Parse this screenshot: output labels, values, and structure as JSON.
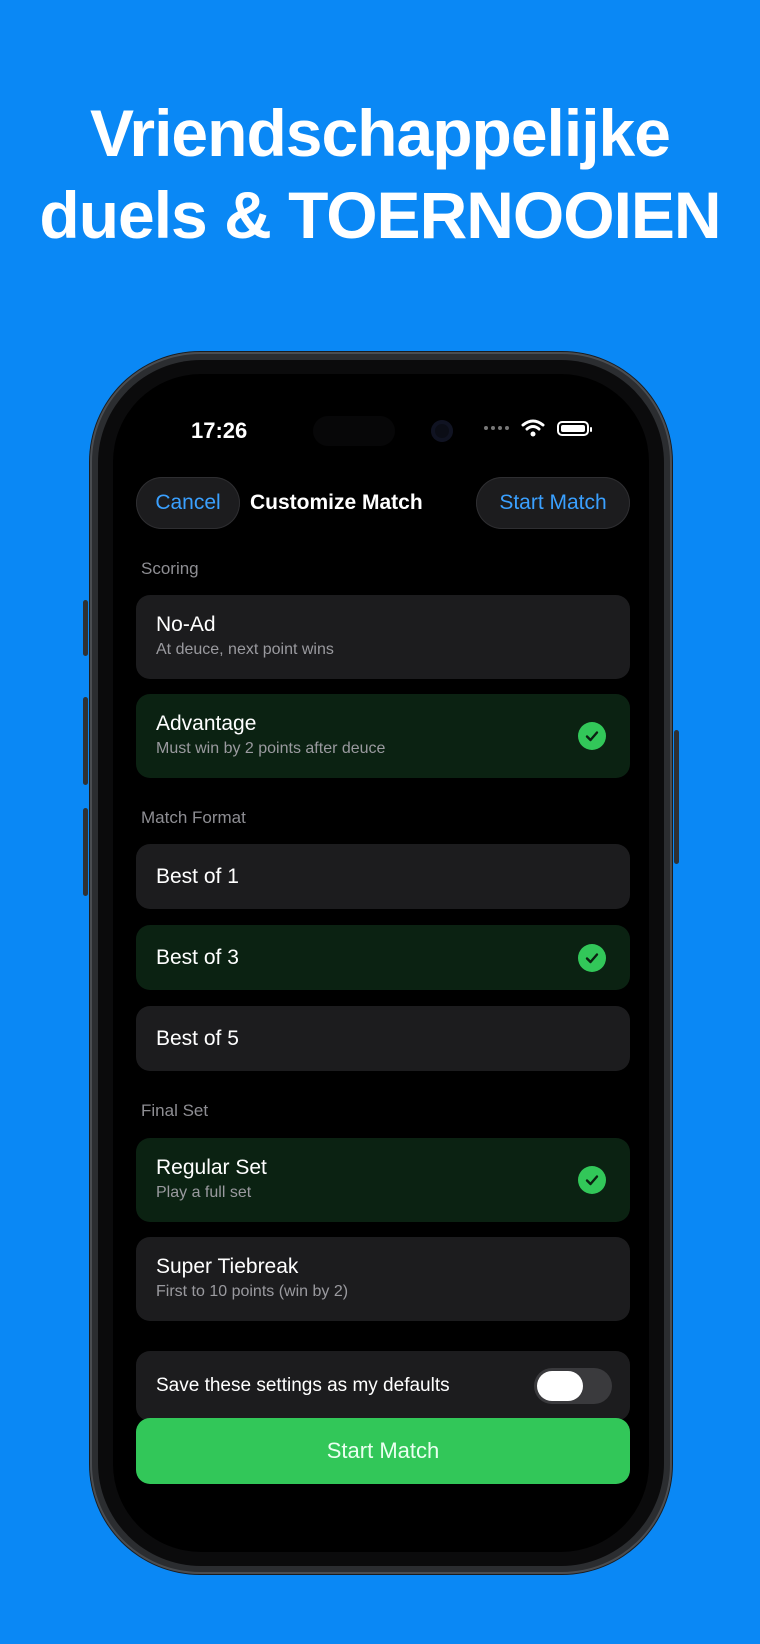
{
  "headline": {
    "line1": "Vriendschappelijke",
    "line2": "duels & TOERNOOIEN"
  },
  "status_bar": {
    "time": "17:26",
    "icons": [
      "cellular-dots-icon",
      "wifi-icon",
      "battery-icon"
    ]
  },
  "nav": {
    "cancel_label": "Cancel",
    "title": "Customize Match",
    "start_label": "Start Match"
  },
  "sections": {
    "scoring": {
      "label": "Scoring",
      "options": [
        {
          "title": "No-Ad",
          "subtitle": "At deuce, next point wins",
          "selected": false
        },
        {
          "title": "Advantage",
          "subtitle": "Must win by 2 points after deuce",
          "selected": true
        }
      ]
    },
    "match_format": {
      "label": "Match Format",
      "options": [
        {
          "title": "Best of 1",
          "selected": false
        },
        {
          "title": "Best of 3",
          "selected": true
        },
        {
          "title": "Best of 5",
          "selected": false
        }
      ]
    },
    "final_set": {
      "label": "Final Set",
      "options": [
        {
          "title": "Regular Set",
          "subtitle": "Play a full set",
          "selected": true
        },
        {
          "title": "Super Tiebreak",
          "subtitle": "First to 10 points (win by 2)",
          "selected": false
        }
      ]
    }
  },
  "defaults_toggle": {
    "label": "Save these settings as my defaults",
    "on": false
  },
  "primary_button": {
    "label": "Start Match"
  },
  "colors": {
    "background": "#0a88f5",
    "accent_blue": "#3aa0ff",
    "accent_green": "#32c759",
    "selected_card": "#0b2212",
    "card": "#1c1c1e"
  }
}
